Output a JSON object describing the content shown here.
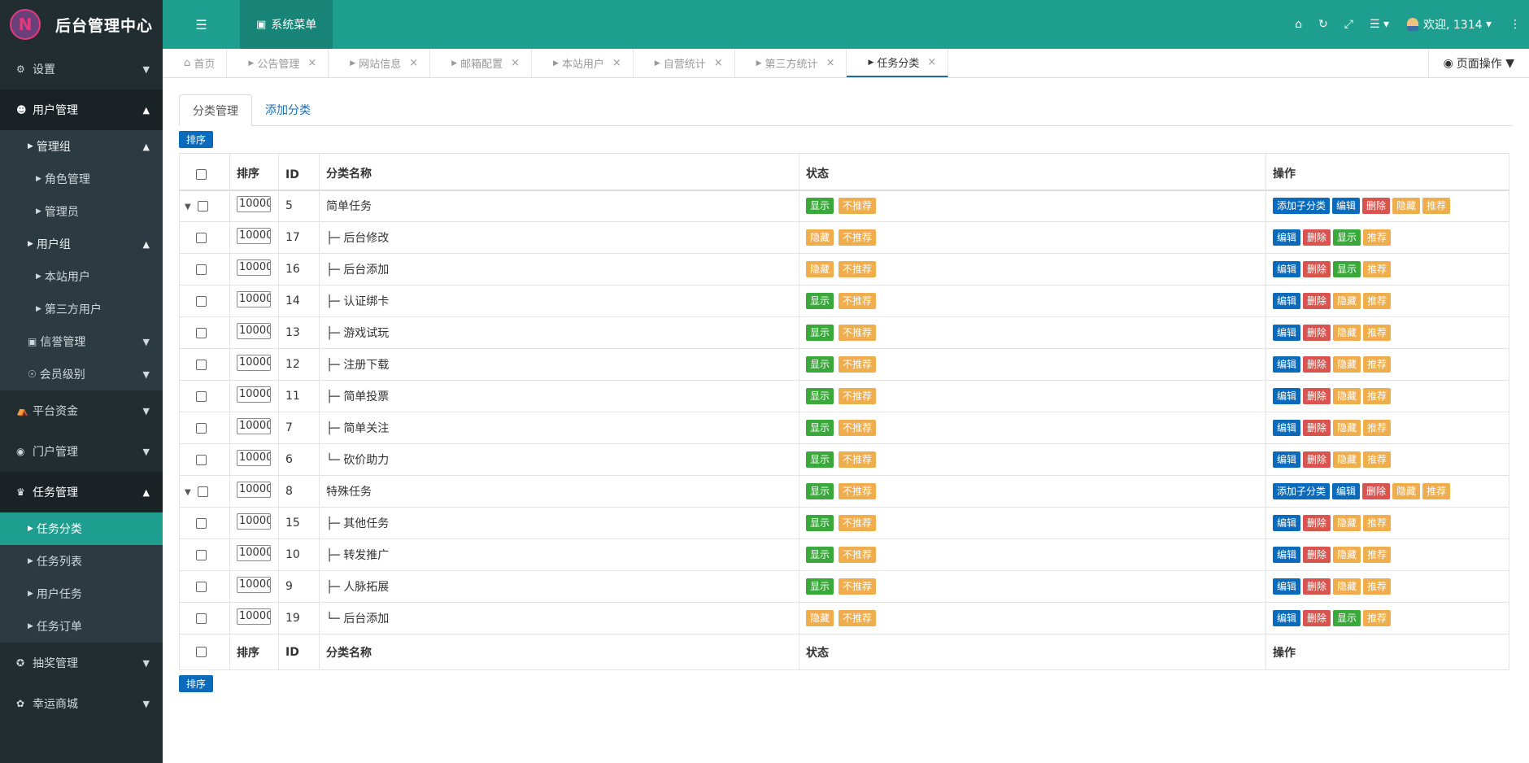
{
  "app": {
    "title": "后台管理中心",
    "logo_letter": "N"
  },
  "topbar": {
    "system_menu": "系统菜单",
    "welcome": "欢迎, 1314"
  },
  "sidebar": {
    "settings": "设置",
    "user_mgmt": "用户管理",
    "admin_group": "管理组",
    "role_mgmt": "角色管理",
    "admins": "管理员",
    "user_group": "用户组",
    "site_users": "本站用户",
    "third_users": "第三方用户",
    "credit_mgmt": "信誉管理",
    "member_level": "会员级别",
    "platform_funds": "平台资金",
    "portal_mgmt": "门户管理",
    "task_mgmt": "任务管理",
    "task_category": "任务分类",
    "task_list": "任务列表",
    "user_tasks": "用户任务",
    "task_orders": "任务订单",
    "lottery_mgmt": "抽奖管理",
    "lucky_mall": "幸运商城"
  },
  "tabs": {
    "home": "首页",
    "notice": "公告管理",
    "site_info": "网站信息",
    "mail": "邮箱配置",
    "site_user": "本站用户",
    "self_stats": "自营统计",
    "third_stats": "第三方统计",
    "task_cat": "任务分类",
    "page_ops": "页面操作"
  },
  "content": {
    "tab_manage": "分类管理",
    "tab_add": "添加分类",
    "sort_button": "排序",
    "columns": {
      "sort": "排序",
      "id": "ID",
      "name": "分类名称",
      "status": "状态",
      "ops": "操作"
    }
  },
  "labels": {
    "show": "显示",
    "hide": "隐藏",
    "not_rec": "不推荐",
    "add_child": "添加子分类",
    "edit": "编辑",
    "delete": "删除",
    "recommend": "推荐"
  },
  "rows": [
    {
      "id": "5",
      "sort": "10000",
      "prefix": "",
      "name": "简单任务",
      "parent": true,
      "status": "显示"
    },
    {
      "id": "17",
      "sort": "10000",
      "prefix": "├─ ",
      "name": "后台修改",
      "parent": false,
      "status": "隐藏"
    },
    {
      "id": "16",
      "sort": "10000",
      "prefix": "├─ ",
      "name": "后台添加",
      "parent": false,
      "status": "隐藏"
    },
    {
      "id": "14",
      "sort": "10000",
      "prefix": "├─ ",
      "name": "认证绑卡",
      "parent": false,
      "status": "显示"
    },
    {
      "id": "13",
      "sort": "10000",
      "prefix": "├─ ",
      "name": "游戏试玩",
      "parent": false,
      "status": "显示"
    },
    {
      "id": "12",
      "sort": "10000",
      "prefix": "├─ ",
      "name": "注册下载",
      "parent": false,
      "status": "显示"
    },
    {
      "id": "11",
      "sort": "10000",
      "prefix": "├─ ",
      "name": "简单投票",
      "parent": false,
      "status": "显示"
    },
    {
      "id": "7",
      "sort": "10000",
      "prefix": "├─ ",
      "name": "简单关注",
      "parent": false,
      "status": "显示"
    },
    {
      "id": "6",
      "sort": "10000",
      "prefix": "└─ ",
      "name": "砍价助力",
      "parent": false,
      "status": "显示"
    },
    {
      "id": "8",
      "sort": "10000",
      "prefix": "",
      "name": "特殊任务",
      "parent": true,
      "status": "显示"
    },
    {
      "id": "15",
      "sort": "10000",
      "prefix": "├─ ",
      "name": "其他任务",
      "parent": false,
      "status": "显示"
    },
    {
      "id": "10",
      "sort": "10000",
      "prefix": "├─ ",
      "name": "转发推广",
      "parent": false,
      "status": "显示"
    },
    {
      "id": "9",
      "sort": "10000",
      "prefix": "├─ ",
      "name": "人脉拓展",
      "parent": false,
      "status": "显示"
    },
    {
      "id": "19",
      "sort": "10000",
      "prefix": "└─ ",
      "name": "后台添加",
      "parent": false,
      "status": "隐藏"
    }
  ]
}
